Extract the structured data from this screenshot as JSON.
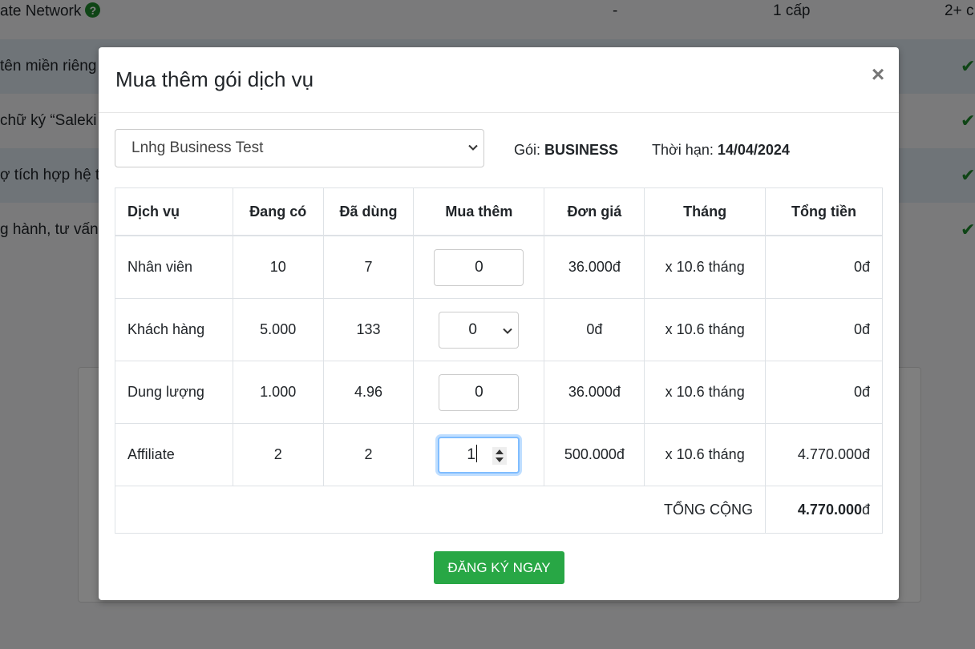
{
  "background": {
    "first_row": {
      "name": "ate Network",
      "col2": "-",
      "col3": "1 cấp",
      "col4": "2+ c",
      "help_icon": "question-circle-icon"
    },
    "rows": [
      {
        "label": "tên miền riêng",
        "check_icon": "check-icon"
      },
      {
        "label": "chữ ký “Saleki",
        "check_icon": "check-icon"
      },
      {
        "label": "ợ tích hợp hệ t",
        "check_icon": "check-icon"
      },
      {
        "label": "g hành, tư vấn",
        "check_icon": "check-icon"
      }
    ]
  },
  "modal": {
    "title": "Mua thêm gói dịch vụ",
    "close_label": "×",
    "plan_select": {
      "value": "Lnhg Business Test"
    },
    "package_label": "Gói:",
    "package_value": "BUSINESS",
    "expiry_label": "Thời hạn:",
    "expiry_value": "14/04/2024",
    "table": {
      "headers": [
        "Dịch vụ",
        "Đang có",
        "Đã dùng",
        "Mua thêm",
        "Đơn giá",
        "Tháng",
        "Tổng tiền"
      ],
      "rows": [
        {
          "service": "Nhân viên",
          "current": "10",
          "used": "7",
          "buy": "0",
          "unit_price": "36.000đ",
          "months": "x 10.6 tháng",
          "total": "0đ"
        },
        {
          "service": "Khách hàng",
          "current": "5.000",
          "used": "133",
          "buy": "0",
          "unit_price": "0đ",
          "months": "x 10.6 tháng",
          "total": "0đ"
        },
        {
          "service": "Dung lượng",
          "current": "1.000",
          "used": "4.96",
          "buy": "0",
          "unit_price": "36.000đ",
          "months": "x 10.6 tháng",
          "total": "0đ"
        },
        {
          "service": "Affiliate",
          "current": "2",
          "used": "2",
          "buy": "1",
          "unit_price": "500.000đ",
          "months": "x 10.6 tháng",
          "total": "4.770.000đ"
        }
      ],
      "sum_label": "TỔNG CỘNG",
      "sum_value": "4.770.000",
      "sum_currency": "đ"
    },
    "submit_label": "ĐĂNG KÝ NGAY"
  },
  "colors": {
    "accent_green": "#28a745",
    "check_green": "#1f8b2c",
    "focus_blue": "#80bdff"
  }
}
